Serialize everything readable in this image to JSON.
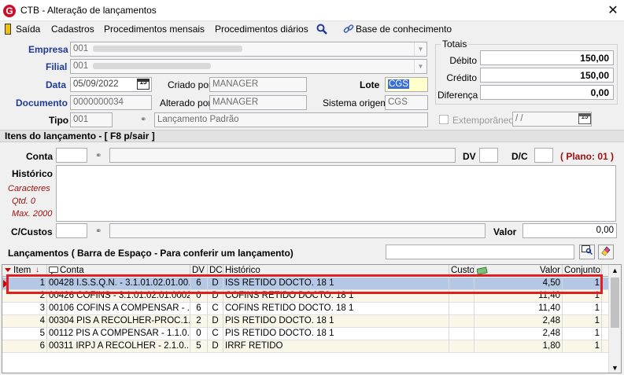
{
  "window": {
    "title": "CTB - Alteração de lançamentos",
    "close": "✕",
    "logo": "G"
  },
  "menu": {
    "exit": "Saída",
    "items": [
      "Cadastros",
      "Procedimentos mensais",
      "Procedimentos diários"
    ],
    "knowledge": "Base de conhecimento"
  },
  "header": {
    "empresa_label": "Empresa",
    "empresa_code": "001",
    "filial_label": "Filial",
    "filial_code": "001",
    "data_label": "Data",
    "data_value": "05/09/2022",
    "criado_label": "Criado por",
    "criado_value": "MANAGER",
    "lote_label": "Lote",
    "lote_value": "CGS",
    "documento_label": "Documento",
    "documento_value": "0000000034",
    "alterado_label": "Alterado por",
    "alterado_value": "MANAGER",
    "sistema_label": "Sistema origem",
    "sistema_value": "CGS",
    "tipo_label": "Tipo",
    "tipo_code": "001",
    "tipo_desc": "Lançamento Padrão"
  },
  "totais": {
    "title": "Totais",
    "debito_label": "Débito",
    "debito_value": "150,00",
    "credito_label": "Crédito",
    "credito_value": "150,00",
    "diferenca_label": "Diferença",
    "diferenca_value": "0,00",
    "extemporaneo_label": "Extemporâneo",
    "extemporaneo_value": " / /"
  },
  "itens": {
    "section_title": "Itens do lançamento - [ F8 p/sair ]",
    "conta_label": "Conta",
    "dv_label": "DV",
    "dc_label": "D/C",
    "plano_text": "( Plano: 01 )",
    "historico_label": "Histórico",
    "caracteres_label": "Caracteres",
    "qtd_label": "Qtd. 0",
    "max_label": "Max. 2000",
    "ccustos_label": "C/Custos",
    "valor_label": "Valor",
    "valor_value": "0,00"
  },
  "lancamentos": {
    "title": "Lançamentos ( Barra de Espaço - Para conferir um lançamento)",
    "columns": {
      "item": "Item",
      "conta": "Conta",
      "dv": "DV",
      "dc": "DC",
      "historico": "Histórico",
      "custo": "Custo",
      "valor": "Valor",
      "conjunto": "Conjunto"
    },
    "rows": [
      {
        "item": "1",
        "conta": "00428 I.S.S.Q.N. - 3.1.01.02.01.00...",
        "dv": "6",
        "dc": "D",
        "historico": "ISS RETIDO DOCTO. 18 1",
        "custo": "",
        "valor": "4,50",
        "conjunto": "1"
      },
      {
        "item": "2",
        "conta": "00426 COFINS - 3.1.01.02.01.0002",
        "dv": "0",
        "dc": "D",
        "historico": "COFINS RETIDO DOCTO. 18 1",
        "custo": "",
        "valor": "11,40",
        "conjunto": "1"
      },
      {
        "item": "3",
        "conta": "00106 COFINS A COMPENSAR - ...",
        "dv": "6",
        "dc": "C",
        "historico": "COFINS RETIDO DOCTO. 18 1",
        "custo": "",
        "valor": "11,40",
        "conjunto": "1"
      },
      {
        "item": "4",
        "conta": "00304 PIS A RECOLHER-PROC.1...",
        "dv": "2",
        "dc": "D",
        "historico": "PIS RETIDO DOCTO. 18 1",
        "custo": "",
        "valor": "2,48",
        "conjunto": "1"
      },
      {
        "item": "5",
        "conta": "00112 PIS A COMPENSAR - 1.1.0...",
        "dv": "0",
        "dc": "C",
        "historico": "PIS RETIDO DOCTO. 18 1",
        "custo": "",
        "valor": "2,48",
        "conjunto": "1"
      },
      {
        "item": "6",
        "conta": "00311 IRPJ A RECOLHER - 2.1.0...",
        "dv": "5",
        "dc": "D",
        "historico": "IRRF RETIDO",
        "custo": "",
        "valor": "1,80",
        "conjunto": "1"
      }
    ]
  }
}
